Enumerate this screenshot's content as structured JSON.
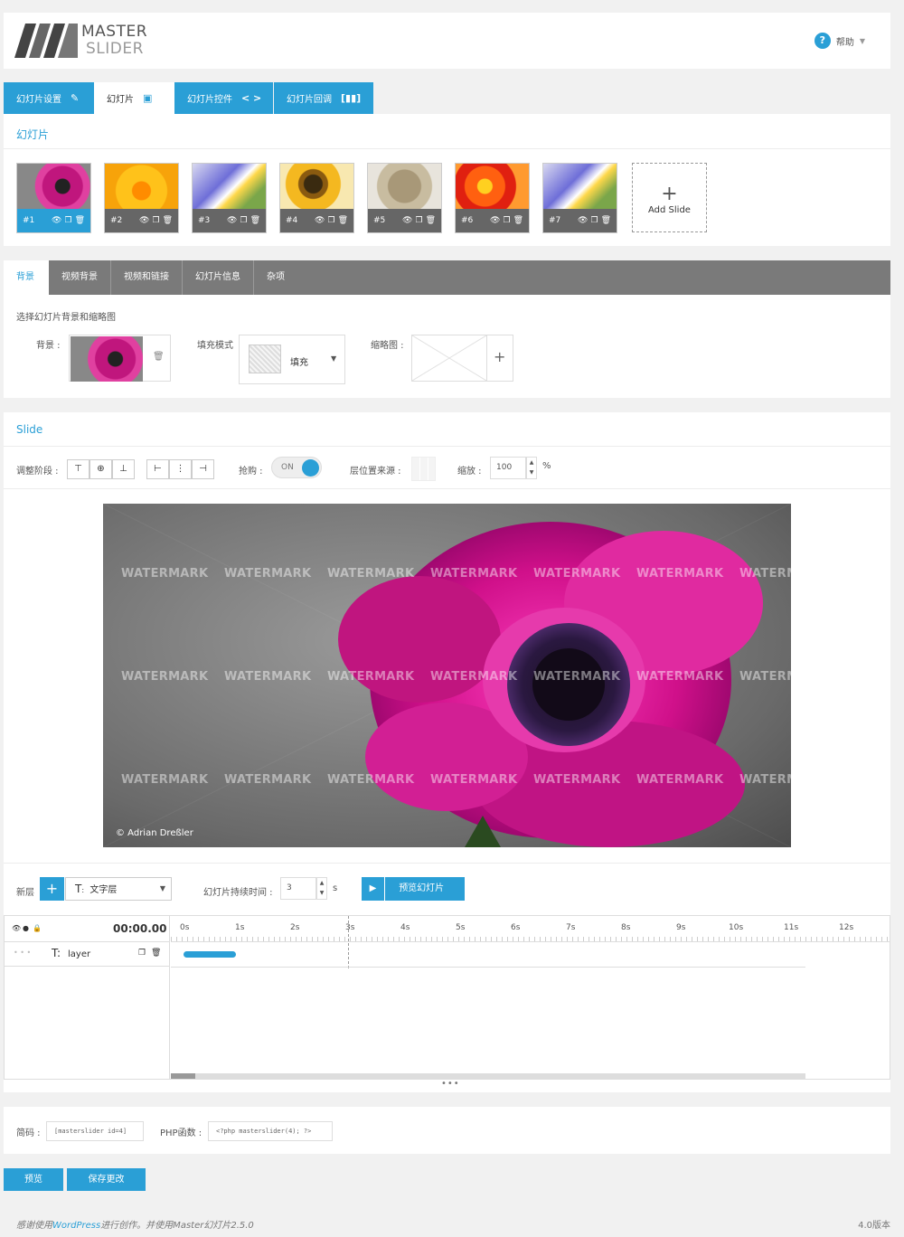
{
  "header": {
    "logo_line1": "MASTER",
    "logo_line2": "SLIDER",
    "help_label": "帮助"
  },
  "main_tabs": [
    {
      "label": "幻灯片设置",
      "icon": "wrench-icon",
      "glyph": "🔧"
    },
    {
      "label": "幻灯片",
      "icon": "slides-icon",
      "glyph": "▭"
    },
    {
      "label": "幻灯片控件",
      "icon": "code-arrows-icon",
      "glyph": "< >"
    },
    {
      "label": "幻灯片回调",
      "icon": "bracket-icon",
      "glyph": "[▮▮▮]"
    }
  ],
  "slides_section": {
    "title": "幻灯片",
    "slides": [
      {
        "label": "#1"
      },
      {
        "label": "#2"
      },
      {
        "label": "#3"
      },
      {
        "label": "#4"
      },
      {
        "label": "#5"
      },
      {
        "label": "#6"
      },
      {
        "label": "#7"
      }
    ],
    "add_label": "Add Slide"
  },
  "sub_tabs": [
    "背景",
    "视频背景",
    "视频和链接",
    "幻灯片信息",
    "杂项"
  ],
  "background": {
    "description": "选择幻灯片背景和缩略图",
    "bg_label": "背景 :",
    "fill_label": "填充模式",
    "fill_value": "填充",
    "thumb_label": "缩略图 :"
  },
  "slide_section": {
    "title": "Slide",
    "align_label": "调整阶段 :",
    "snap_label": "抢购 :",
    "toggle_text": "ON",
    "layer_source_label": "层位置来源 :",
    "zoom_label": "缩放 :",
    "zoom_value": "100",
    "zoom_unit": "%",
    "watermark": "WATERMARK",
    "credit": "© Adrian Dreßler"
  },
  "layers": {
    "new_layer_label": "新层",
    "layer_type": "文字层",
    "duration_label": "幻灯片持续时间 :",
    "duration_value": "3",
    "duration_unit": "s",
    "preview_label": "预览幻灯片",
    "time_display": "00:00.00",
    "ticks": [
      "0s",
      "1s",
      "2s",
      "3s",
      "4s",
      "5s",
      "6s",
      "7s",
      "8s",
      "9s",
      "10s",
      "11s",
      "12s"
    ],
    "layer_name": "layer"
  },
  "code": {
    "shortcode_label": "简码 :",
    "shortcode_value": "[masterslider id=4]",
    "php_label": "PHP函数 :",
    "php_value": "<?php masterslider(4); ?>"
  },
  "buttons": {
    "preview": "预览",
    "save": "保存更改"
  },
  "footer": {
    "thanks_prefix": "感谢使用",
    "wp_link": "WordPress",
    "thanks_suffix": "进行创作。并使用Master幻灯片2.5.0",
    "version": "4.0版本"
  },
  "colors": {
    "accent": "#2a9fd6",
    "subtab_bar": "#7a7a7a",
    "thumb_bar": "#666666"
  }
}
